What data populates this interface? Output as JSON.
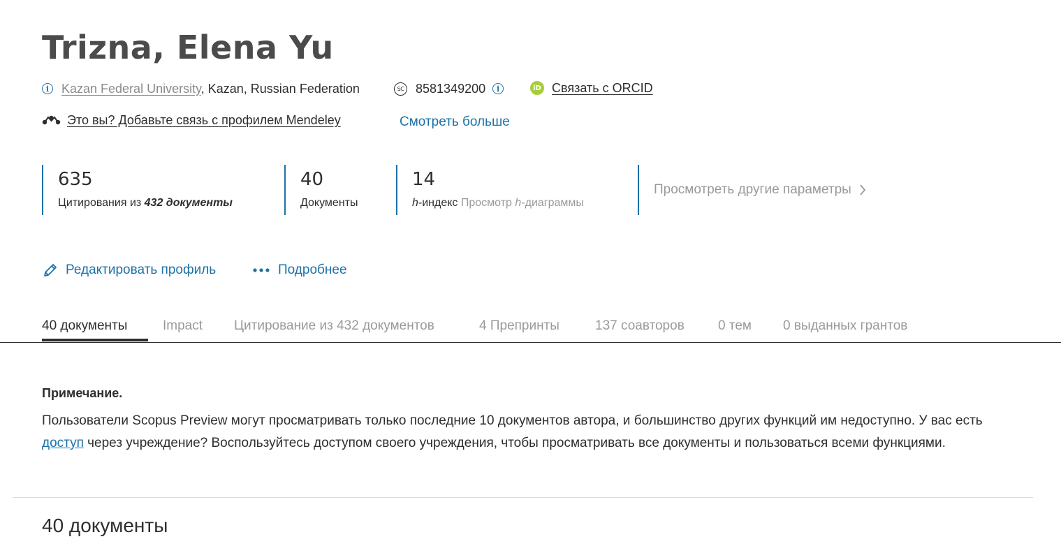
{
  "author": {
    "name": "Trizna, Elena Yu",
    "affiliation_link": "Kazan Federal University",
    "affiliation_rest": ", Kazan, Russian Federation",
    "scopus_id": "8581349200",
    "orcid_label": "Связать с ORCID",
    "mendeley_link": "Это вы? Добавьте связь с профилем Mendeley",
    "see_more": "Смотреть больше"
  },
  "metrics": {
    "citations_value": "635",
    "citations_label_prefix": "Цитирования из ",
    "citations_label_docs": "432 документы",
    "documents_value": "40",
    "documents_label": "Документы",
    "hindex_value": "14",
    "hindex_h": "h",
    "hindex_label": "-индекс",
    "hindex_link_prefix": " Просмотр ",
    "hindex_link_h": "h",
    "hindex_link_suffix": "-диаграммы",
    "other_params": "Просмотреть другие параметры"
  },
  "actions": {
    "edit_profile": "Редактировать профиль",
    "more": "Подробнее"
  },
  "tabs": [
    {
      "label": "40 документы",
      "active": true
    },
    {
      "label": "Impact"
    },
    {
      "label": "Цитирование из 432 документов"
    },
    {
      "label": "4 Препринты"
    },
    {
      "label": "137 соавторов"
    },
    {
      "label": "0 тем"
    },
    {
      "label": "0 выданных грантов"
    }
  ],
  "note": {
    "title": "Примечание.",
    "body_part1": "Пользователи Scopus Preview могут просматривать только последние 10 документов автора, и большинство других функций им недоступно. У вас есть ",
    "body_link": "доступ",
    "body_part2": " через учреждение? Воспользуйтесь доступом своего учреждения, чтобы просматривать все документы и пользоваться всеми функциями."
  },
  "documents_heading": "40 документы",
  "colors": {
    "accent": "#1d72a8",
    "orcid": "#a6ce39",
    "text": "#2e2e2e",
    "muted": "#9a9a9a"
  },
  "icons": {
    "info": "info-icon",
    "scopus": "scopus-id-icon",
    "orcid": "orcid-icon",
    "mendeley": "mendeley-icon",
    "edit": "pencil-icon",
    "more": "ellipsis-icon",
    "chevron": "chevron-right-icon"
  }
}
